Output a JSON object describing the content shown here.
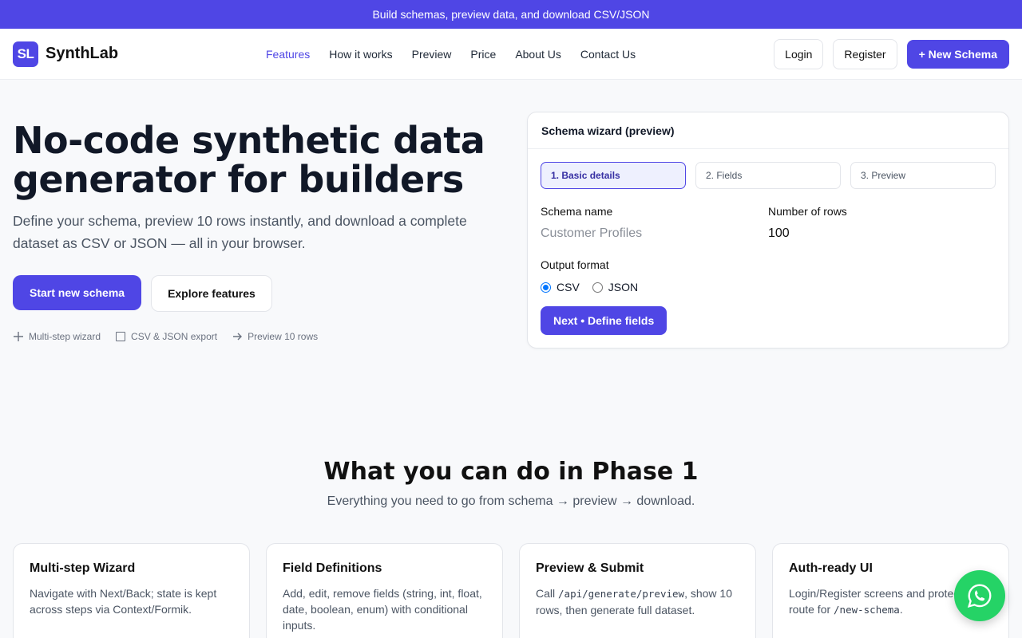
{
  "announcement": "Build schemas, preview data, and download CSV/JSON",
  "brand": {
    "logo_text": "SL",
    "name": "SynthLab"
  },
  "nav": {
    "links": [
      {
        "label": "Features",
        "active": true
      },
      {
        "label": "How it works"
      },
      {
        "label": "Preview"
      },
      {
        "label": "Price"
      },
      {
        "label": "About Us"
      },
      {
        "label": "Contact Us"
      }
    ],
    "login": "Login",
    "register": "Register",
    "new_schema": "+ New Schema"
  },
  "hero": {
    "title_line1": "No-code synthetic data",
    "title_line2": "generator for builders",
    "subtitle": "Define your schema, preview 10 rows instantly, and download a complete dataset as CSV or JSON — all in your browser.",
    "primary_cta": "Start new schema",
    "secondary_cta": "Explore features",
    "features": [
      "Multi-step wizard",
      "CSV & JSON export",
      "Preview 10 rows"
    ]
  },
  "wizard": {
    "title": "Schema wizard (preview)",
    "steps": [
      "1. Basic details",
      "2. Fields",
      "3. Preview"
    ],
    "schema_name_label": "Schema name",
    "schema_name_placeholder": "Customer Profiles",
    "rows_label": "Number of rows",
    "rows_value": "100",
    "format_label": "Output format",
    "formats": [
      "CSV",
      "JSON"
    ],
    "selected_format": "CSV",
    "next_button": "Next • Define fields"
  },
  "section": {
    "title": "What you can do in Phase 1",
    "subtitle": "Everything you need to go from schema → preview → download."
  },
  "cards": [
    {
      "title": "Multi-step Wizard",
      "text": "Navigate with Next/Back; state is kept across steps via Context/Formik."
    },
    {
      "title": "Field Definitions",
      "text": "Add, edit, remove fields (string, int, float, date, boolean, enum) with conditional inputs."
    },
    {
      "title": "Preview & Submit",
      "text_pre": "Call ",
      "code": "/api/generate/preview",
      "text_post": ", show 10 rows, then generate full dataset."
    },
    {
      "title": "Auth-ready UI",
      "text_pre": "Login/Register screens and protected route for ",
      "code": "/new-schema",
      "text_post": "."
    }
  ],
  "colors": {
    "accent": "#4f46e5",
    "whatsapp": "#25d366"
  },
  "icons": [
    "plus-icon",
    "checkbox-icon",
    "arrow-right-icon",
    "whatsapp-icon"
  ]
}
